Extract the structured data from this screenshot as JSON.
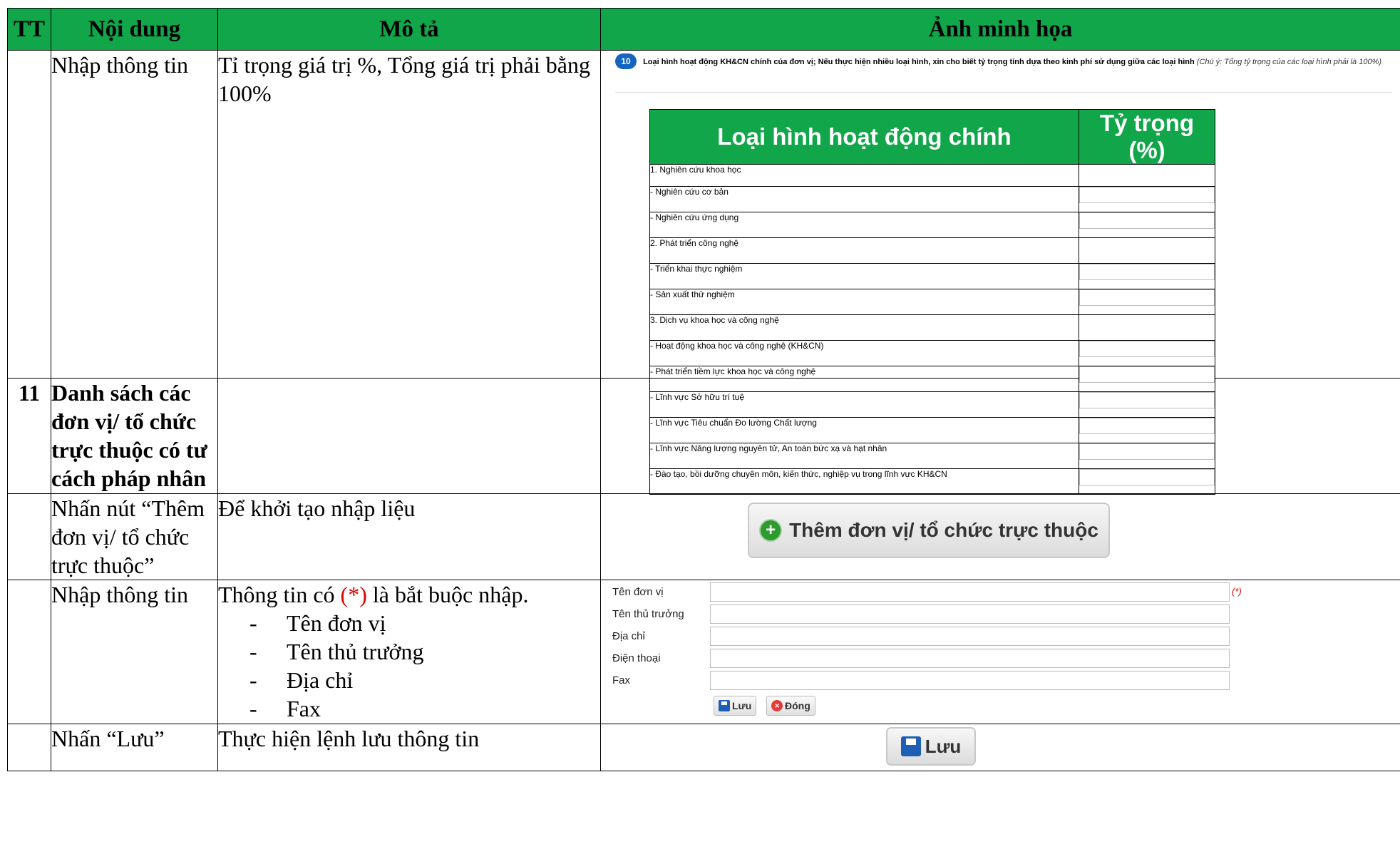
{
  "header": {
    "tt": "TT",
    "content": "Nội dung",
    "desc": "Mô tả",
    "image": "Ảnh minh họa"
  },
  "rows": {
    "r1": {
      "content": "Nhập thông tin",
      "desc": "Tỉ trọng giá trị %, Tổng giá trị phải bằng 100%"
    },
    "r2": {
      "tt": "11",
      "content": "Danh sách các đơn vị/ tổ chức trực thuộc có tư cách pháp nhân"
    },
    "r3": {
      "content": "Nhấn nút “Thêm đơn vị/ tổ chức trực thuộc”",
      "desc": "Để khởi tạo nhập liệu"
    },
    "r4": {
      "content": "Nhập thông tin",
      "desc_prefix": "Thông tin có ",
      "desc_required": "(*)",
      "desc_suffix": " là bắt buộc nhập.",
      "list": [
        "Tên đơn vị",
        "Tên thủ trưởng",
        "Địa chỉ",
        "Fax"
      ]
    },
    "r5": {
      "content": "Nhấn “Lưu”",
      "desc": "Thực hiện lệnh lưu thông tin"
    }
  },
  "illustration_q10": {
    "badge": "10",
    "question": "Loại hình hoạt động KH&CN chính của đơn vị; Nếu thực hiện nhiều loại hình, xin cho biết tỷ trọng tính dựa theo kinh phí sử dụng giữa các loại hình",
    "note": "(Chú ý: Tổng tỷ trọng của các loại hình phải là 100%)",
    "col1": "Loại hình hoạt động chính",
    "col2": "Tỷ trọng (%)",
    "items": [
      "1. Nghiên cứu khoa học",
      "- Nghiên cứu cơ bản",
      "- Nghiên cứu ứng dụng",
      "2. Phát triển công nghệ",
      "- Triển khai thực nghiệm",
      "- Sản xuất thử nghiệm",
      "3. Dịch vụ khoa học và công nghệ",
      "- Hoạt động khoa học và công nghệ (KH&CN)",
      "- Phát triển tiềm lực khoa học và công nghệ",
      "- Lĩnh vực Sở hữu trí tuệ",
      "- Lĩnh vực Tiêu chuẩn Đo lường Chất lượng",
      "- Lĩnh vực Năng lượng nguyên tử, An toàn bức xạ và hạt nhân",
      "- Đào tạo, bồi dưỡng chuyên môn, kiến thức, nghiệp vụ trong lĩnh vực KH&CN"
    ]
  },
  "add_button": {
    "label": "Thêm đơn vị/ tổ chức trực thuộc"
  },
  "form": {
    "labels": [
      "Tên đơn vị",
      "Tên thủ trưởng",
      "Địa chỉ",
      "Điện thoại",
      "Fax"
    ],
    "required": "(*)",
    "save": "Lưu",
    "close": "Đóng"
  },
  "save_button": {
    "label": "Lưu"
  }
}
